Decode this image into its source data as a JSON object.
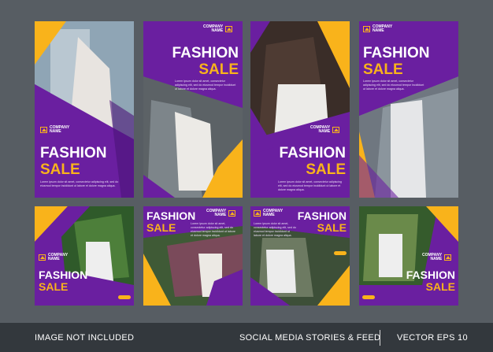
{
  "colors": {
    "purple": "#6a1fa0",
    "purple_dark": "#4b1478",
    "yellow": "#f9b31b",
    "background": "#575d63",
    "footer": "#33383d"
  },
  "brand": {
    "company": "COMPANY",
    "name": "NAME"
  },
  "headline": {
    "line1": "FASHION",
    "line2": "SALE"
  },
  "body_text": "Lorem ipsum dolor sit amet, consectetur adipiscing elit, sed do eiusmod tempor incididunt ut labore et dolore magna aliqua.",
  "footer": {
    "left": "IMAGE NOT INCLUDED",
    "center": "SOCIAL MEDIA STORIES & FEED",
    "right": "VECTOR EPS 10"
  }
}
